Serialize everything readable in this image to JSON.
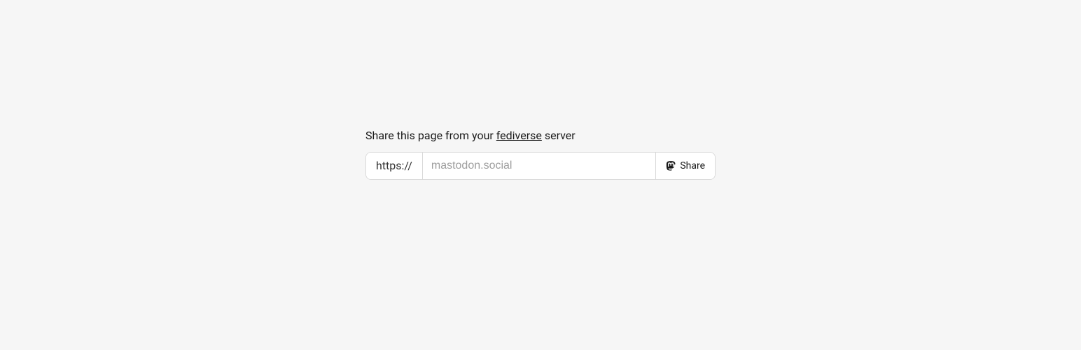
{
  "prompt": {
    "before": "Share this page from your ",
    "link_text": "fediverse",
    "after": " server"
  },
  "form": {
    "prefix": "https://",
    "placeholder": "mastodon.social",
    "value": "",
    "button_label": "Share"
  }
}
